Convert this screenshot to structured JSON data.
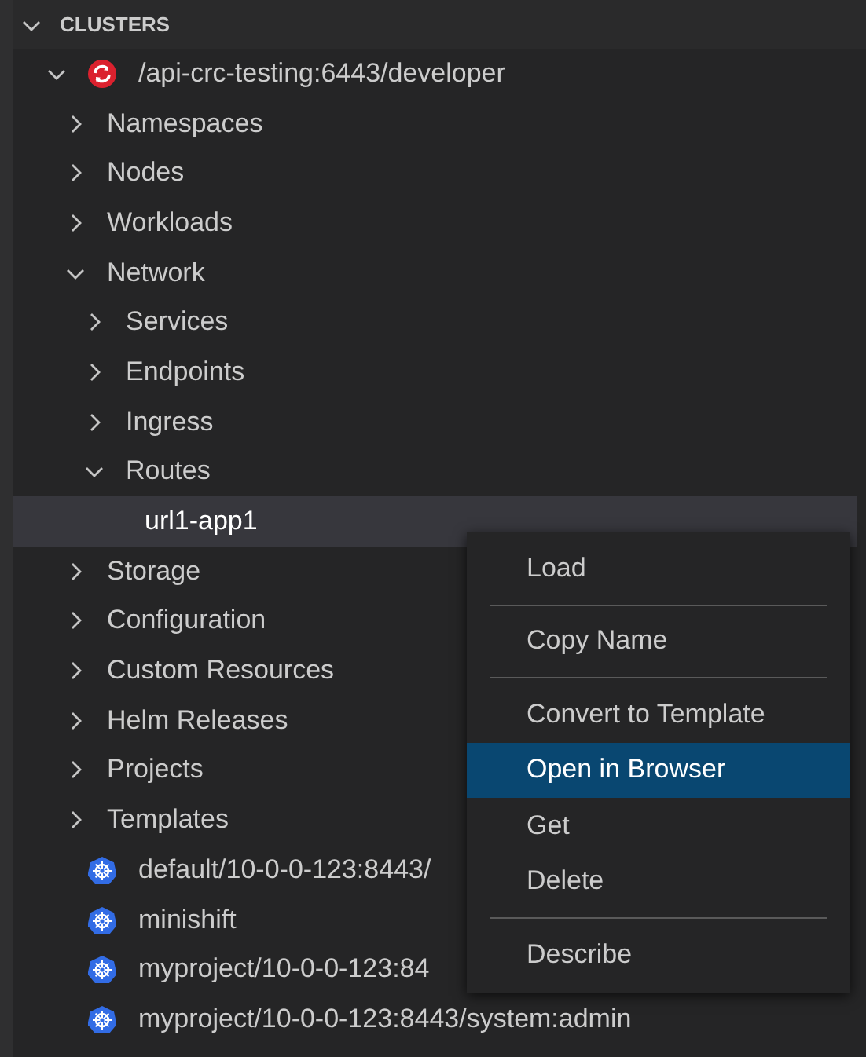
{
  "section": {
    "title": "CLUSTERS",
    "expanded": true
  },
  "tree": [
    {
      "label": "/api-crc-testing:6443/developer",
      "kind": "openshift-cluster",
      "expanded": true,
      "selected": false,
      "children": [
        {
          "label": "Namespaces",
          "expanded": false,
          "selected": false
        },
        {
          "label": "Nodes",
          "expanded": false,
          "selected": false
        },
        {
          "label": "Workloads",
          "expanded": false,
          "selected": false
        },
        {
          "label": "Network",
          "expanded": true,
          "selected": false,
          "children": [
            {
              "label": "Services",
              "expanded": false,
              "selected": false
            },
            {
              "label": "Endpoints",
              "expanded": false,
              "selected": false
            },
            {
              "label": "Ingress",
              "expanded": false,
              "selected": false
            },
            {
              "label": "Routes",
              "expanded": true,
              "selected": false,
              "children": [
                {
                  "label": "url1-app1",
                  "selected": true
                }
              ]
            }
          ]
        },
        {
          "label": "Storage",
          "expanded": false,
          "selected": false
        },
        {
          "label": "Configuration",
          "expanded": false,
          "selected": false
        },
        {
          "label": "Custom Resources",
          "expanded": false,
          "selected": false
        },
        {
          "label": "Helm Releases",
          "expanded": false,
          "selected": false
        },
        {
          "label": "Projects",
          "expanded": false,
          "selected": false
        },
        {
          "label": "Templates",
          "expanded": false,
          "selected": false
        }
      ]
    },
    {
      "label": "default/10-0-0-123:8443/",
      "kind": "kube-context",
      "selected": false
    },
    {
      "label": "minishift",
      "kind": "kube-context",
      "selected": false
    },
    {
      "label": "myproject/10-0-0-123:84",
      "kind": "kube-context",
      "selected": false
    },
    {
      "label": "myproject/10-0-0-123:8443/system:admin",
      "kind": "kube-context",
      "selected": false
    }
  ],
  "context_menu": {
    "groups": [
      [
        {
          "label": "Load",
          "selected": false
        }
      ],
      [
        {
          "label": "Copy Name",
          "selected": false
        }
      ],
      [
        {
          "label": "Convert to Template",
          "selected": false
        },
        {
          "label": "Open in Browser",
          "selected": true
        },
        {
          "label": "Get",
          "selected": false
        },
        {
          "label": "Delete",
          "selected": false
        }
      ],
      [
        {
          "label": "Describe",
          "selected": false
        }
      ]
    ]
  }
}
